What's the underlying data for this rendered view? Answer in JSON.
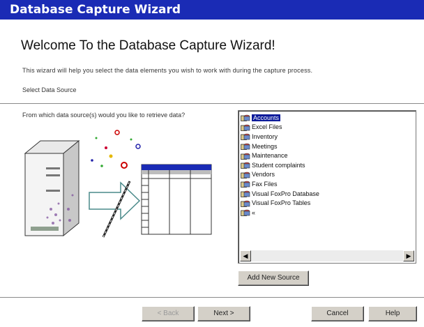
{
  "window": {
    "title": "Database Capture Wizard"
  },
  "welcome": {
    "headline": "Welcome To the Database Capture Wizard!",
    "intro": "This wizard will help you select the data elements you wish to work with during the capture process.",
    "sub": "Select Data Source"
  },
  "source": {
    "prompt": "From which data source(s) would you like to retrieve data?",
    "items": [
      "Accounts",
      "Excel Files",
      "Inventory",
      "Meetings",
      "Maintenance",
      "Student complaints",
      "Vendors",
      "Fax Files",
      "Visual FoxPro Database",
      "Visual FoxPro Tables",
      "«"
    ],
    "selected_index": 0,
    "add_button": "Add New Source"
  },
  "buttons": {
    "back": "< Back",
    "next": "Next >",
    "cancel": "Cancel",
    "help": "Help"
  },
  "icons": {
    "scroll_left": "left-arrow-icon",
    "scroll_right": "right-arrow-icon",
    "data_source": "database-icon"
  }
}
